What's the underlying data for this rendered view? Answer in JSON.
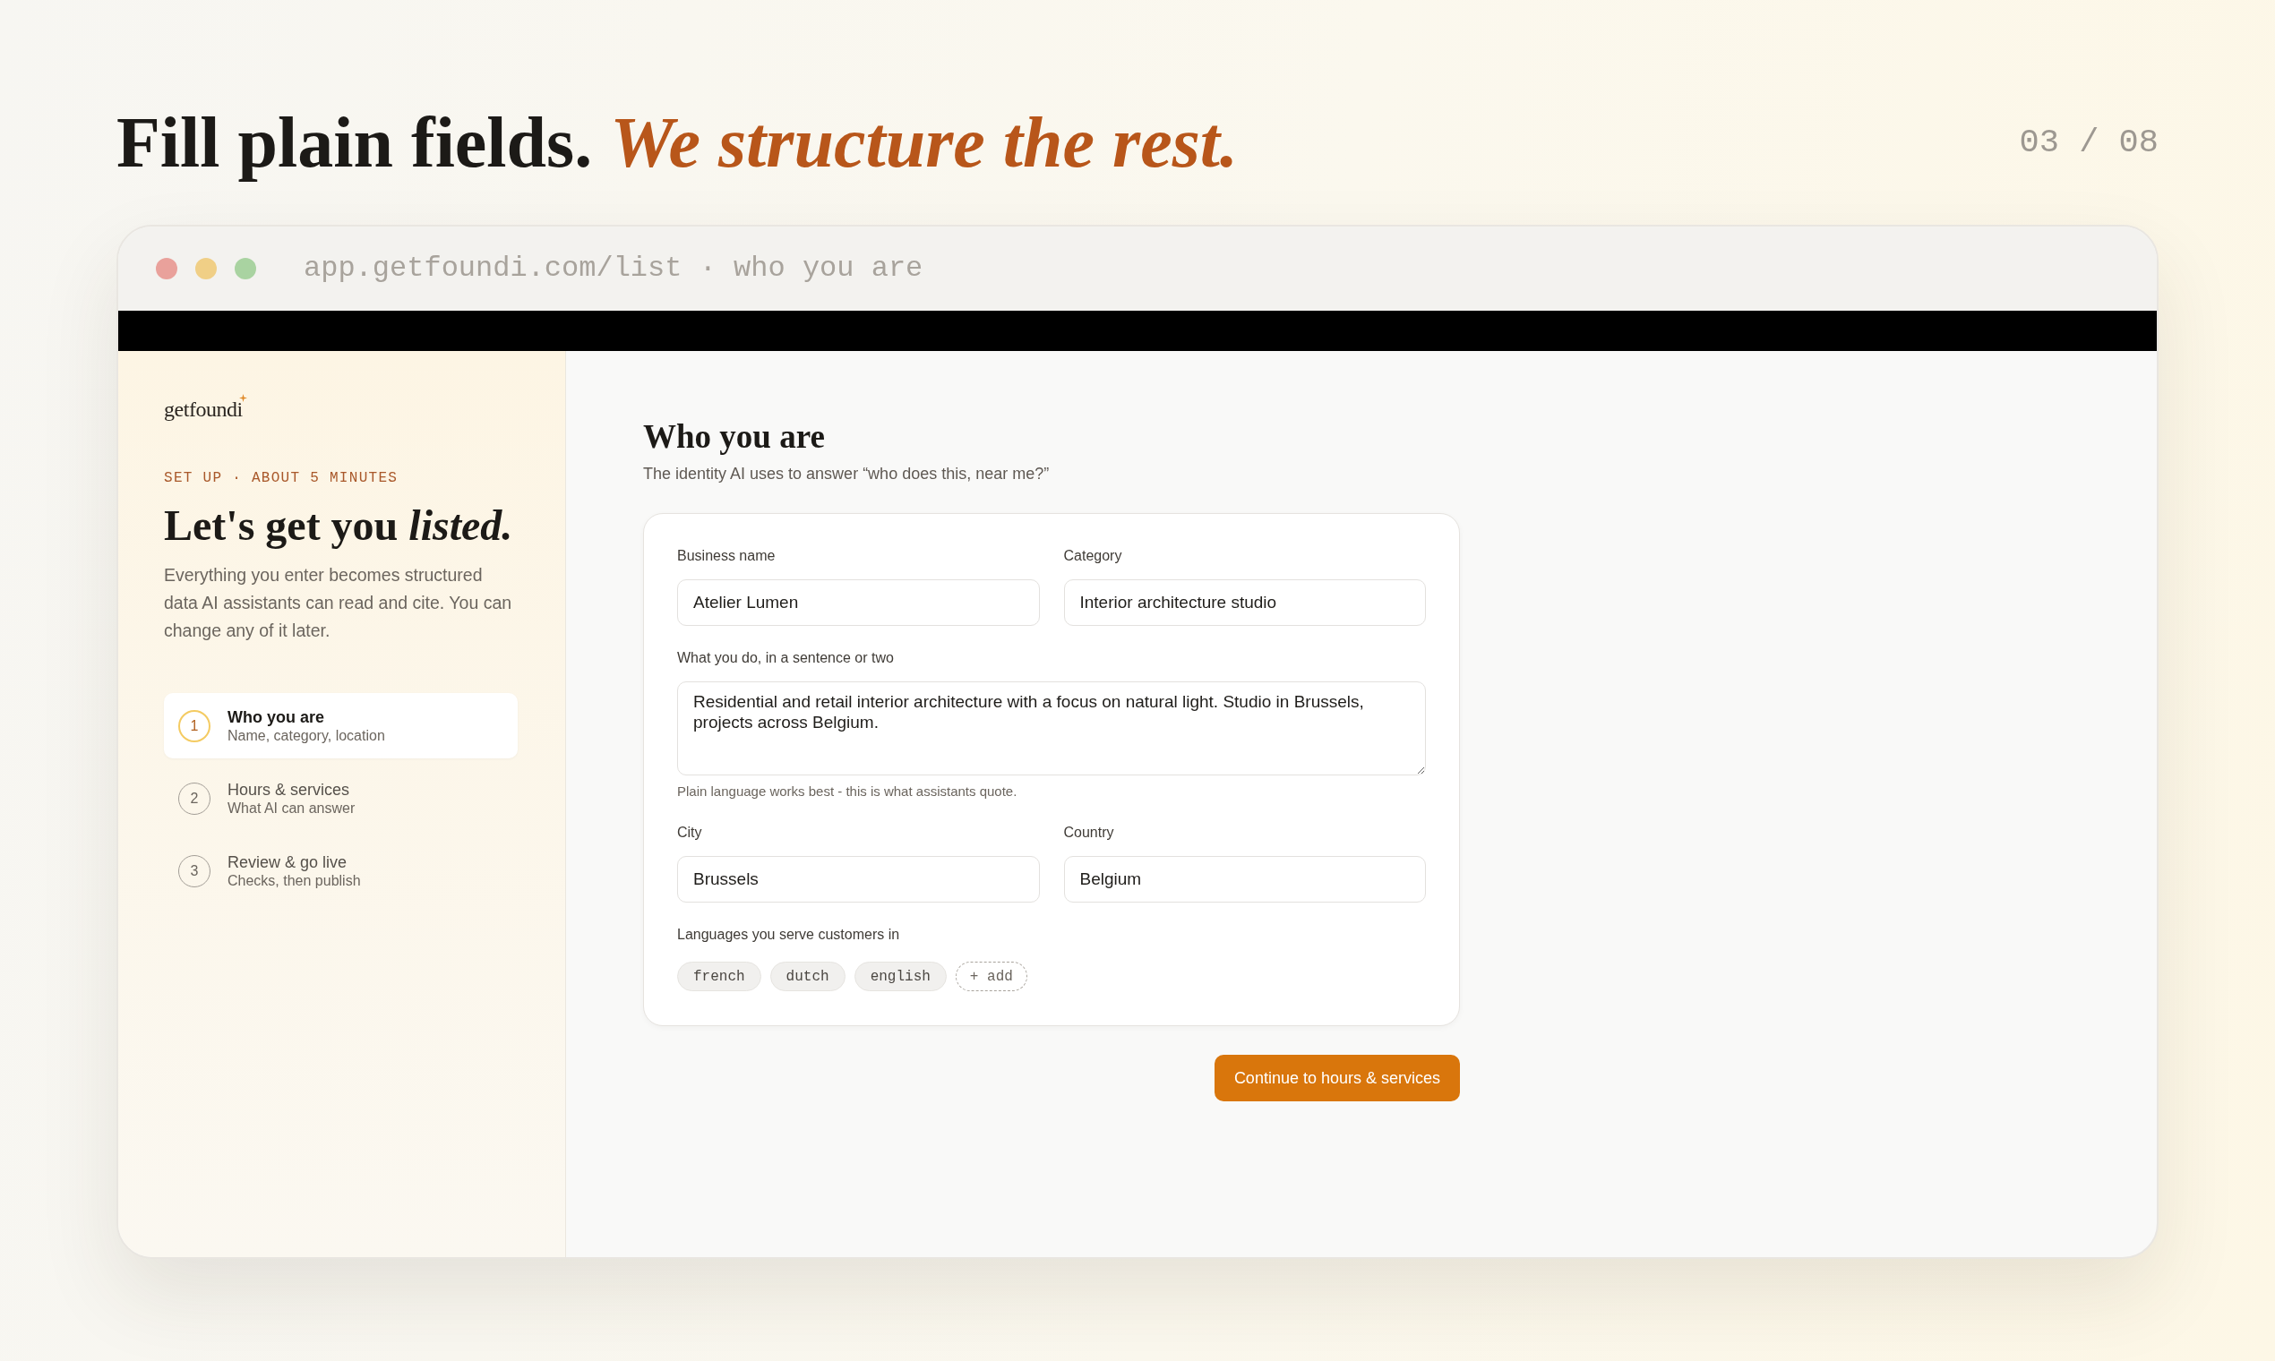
{
  "header": {
    "title": "Fill plain fields. *We structure the rest.*",
    "counter": "03 / 08"
  },
  "browser": {
    "url": "app.getfoundi.com/list · who you are"
  },
  "sidebar": {
    "logo": "getfoundi",
    "eyebrow": "SET UP · ABOUT 5 MINUTES",
    "title": "Let's get you *listed.*",
    "intro": "Everything you enter becomes structured data AI assistants can read and cite. You can change any of it later.",
    "steps": [
      {
        "number": "1",
        "title": "Who you are",
        "subtitle": "Name, category, location",
        "selected": true
      },
      {
        "number": "2",
        "title": "Hours & services",
        "subtitle": "What AI can answer",
        "selected": false
      },
      {
        "number": "3",
        "title": "Review & go live",
        "subtitle": "Checks, then publish",
        "selected": false
      }
    ]
  },
  "main": {
    "title": "Who you are",
    "subtitle": "The identity AI uses to answer “who does this, near me?”",
    "form": {
      "rows": [
        [
          {
            "kind": "text",
            "label": "Business name",
            "value": "Atelier Lumen"
          },
          {
            "kind": "text",
            "label": "Category",
            "value": "Interior architecture studio"
          }
        ],
        [
          {
            "kind": "textarea",
            "label": "What you do, in a sentence or two",
            "value": "Residential and retail interior architecture with a focus on natural light. Studio in Brussels, projects across Belgium.",
            "hint": "Plain language works best - this is what assistants quote."
          }
        ],
        [
          {
            "kind": "text",
            "label": "City",
            "value": "Brussels"
          },
          {
            "kind": "text",
            "label": "Country",
            "value": "Belgium"
          }
        ]
      ],
      "languages": {
        "label": "Languages you serve customers in",
        "tags": [
          "french",
          "dutch",
          "english"
        ],
        "add_label": "+ add"
      }
    },
    "continue_button": "Continue to hours & services"
  }
}
